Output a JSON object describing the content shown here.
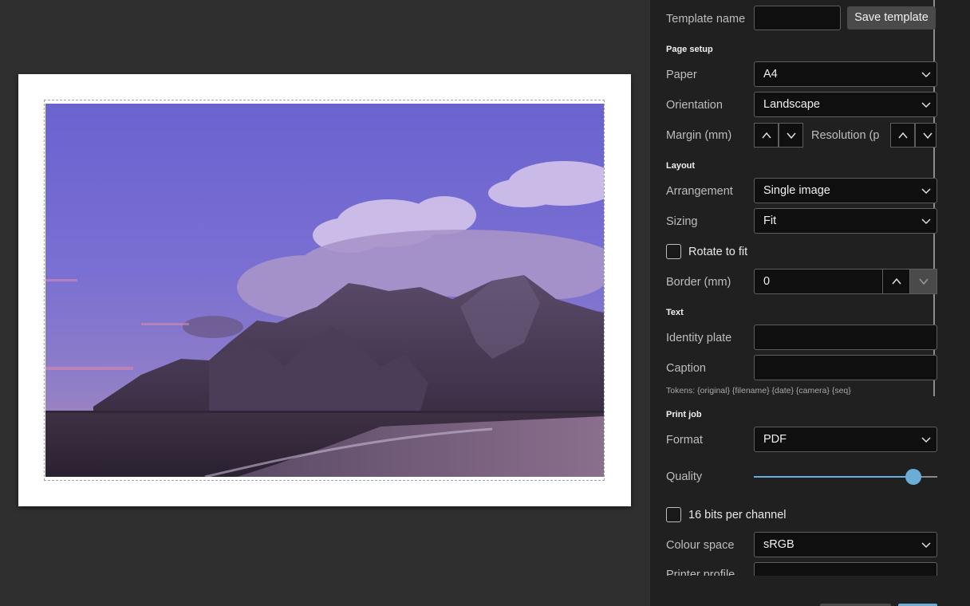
{
  "template": {
    "name_label": "Template name",
    "name_value": "",
    "save_label": "Save template"
  },
  "page_setup": {
    "heading": "Page setup",
    "paper_label": "Paper",
    "paper_value": "A4",
    "orientation_label": "Orientation",
    "orientation_value": "Landscape",
    "margin_label": "Margin (mm)",
    "resolution_label": "Resolution (p"
  },
  "layout": {
    "heading": "Layout",
    "arrangement_label": "Arrangement",
    "arrangement_value": "Single image",
    "sizing_label": "Sizing",
    "sizing_value": "Fit",
    "rotate_label": "Rotate to fit",
    "rotate_checked": false,
    "border_label": "Border (mm)",
    "border_value": "0"
  },
  "text": {
    "heading": "Text",
    "identity_label": "Identity plate",
    "identity_value": "",
    "caption_label": "Caption",
    "caption_value": "",
    "tokens": "Tokens: {original} {filename} {date} {camera} {seq}"
  },
  "print_job": {
    "heading": "Print job",
    "format_label": "Format",
    "format_value": "PDF",
    "quality_label": "Quality",
    "quality_fraction": 0.87,
    "bits_label": "16 bits per channel",
    "bits_checked": false,
    "colour_label": "Colour space",
    "colour_value": "sRGB",
    "printer_label": "Printer profile"
  },
  "colors": {
    "accent": "#6aaed8",
    "panel": "#202020",
    "canvas": "#2f2f2f"
  },
  "icons": {
    "dropdown": "chevron-down-icon",
    "step_up": "chevron-up-icon",
    "step_down": "chevron-down-icon"
  }
}
